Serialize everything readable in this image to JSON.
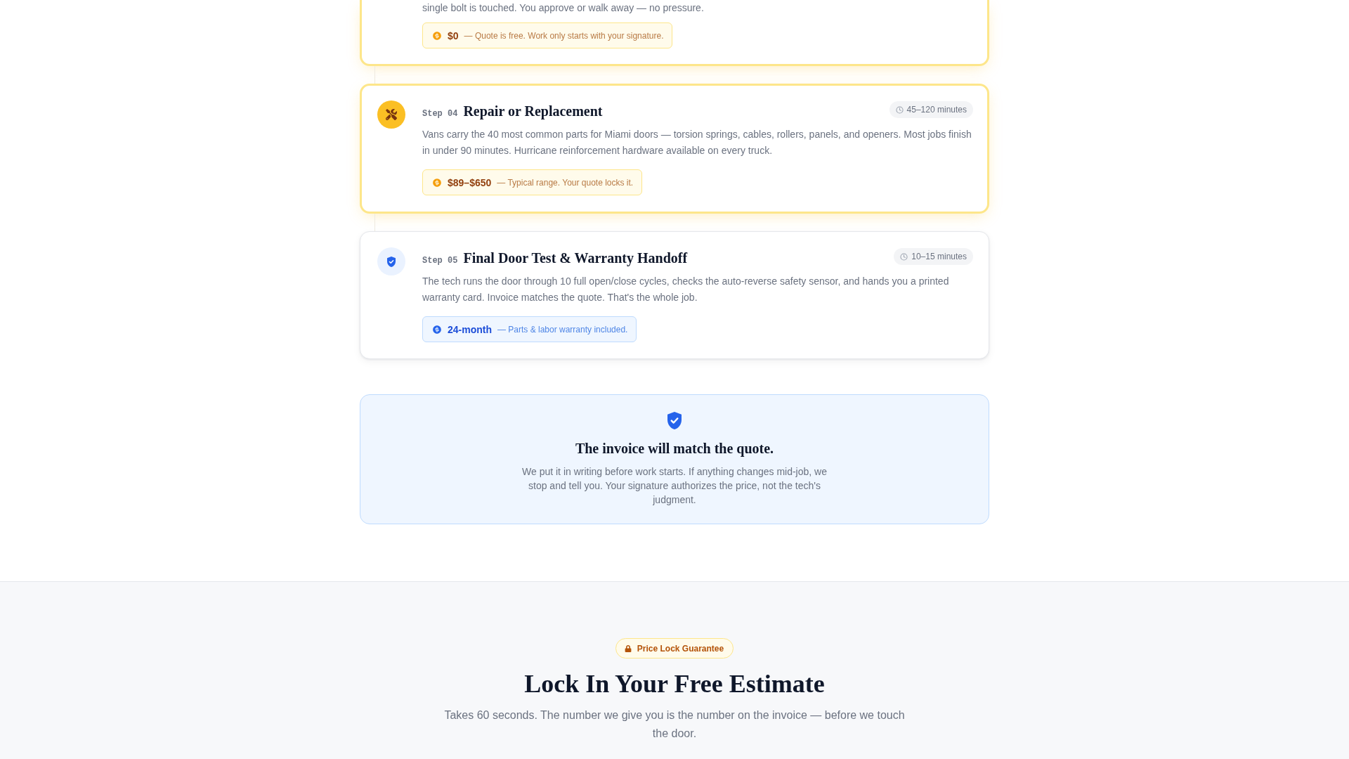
{
  "steps": [
    {
      "description": "single bolt is touched. You approve or walk away — no pressure.",
      "price": {
        "kind": "cost",
        "amount": "$0",
        "note": "— Quote is free. Work only starts with your signature."
      },
      "highlighted": true
    },
    {
      "label": "Step 04",
      "title": "Repair or Replacement",
      "duration": "45–120 minutes",
      "description": "Vans carry the 40 most common parts for Miami doors — torsion springs, cables, rollers, panels, and openers. Most jobs finish in under 90 minutes. Hurricane reinforcement hardware available on every truck.",
      "price": {
        "kind": "cost",
        "amount": "$89–$650",
        "note": "— Typical range. Your quote locks it."
      },
      "highlighted": true
    },
    {
      "label": "Step 05",
      "title": "Final Door Test & Warranty Handoff",
      "duration": "10–15 minutes",
      "description": "The tech runs the door through 10 full open/close cycles, checks the auto-reverse safety sensor, and hands you a printed warranty card. Invoice matches the quote. That's the whole job.",
      "price": {
        "kind": "warranty",
        "amount": "24-month",
        "note": "— Parts & labor warranty included."
      },
      "highlighted": false
    }
  ],
  "guarantee": {
    "title": "The invoice will match the quote.",
    "text": "We put it in writing before work starts. If anything changes mid-job, we stop and tell you. Your signature authorizes the price, not the tech's judgment."
  },
  "estimate": {
    "badge": "Price Lock Guarantee",
    "title": "Lock In Your Free Estimate",
    "subtitle": "Takes 60 seconds. The number we give you is the number on the invoice — before we touch the door."
  }
}
